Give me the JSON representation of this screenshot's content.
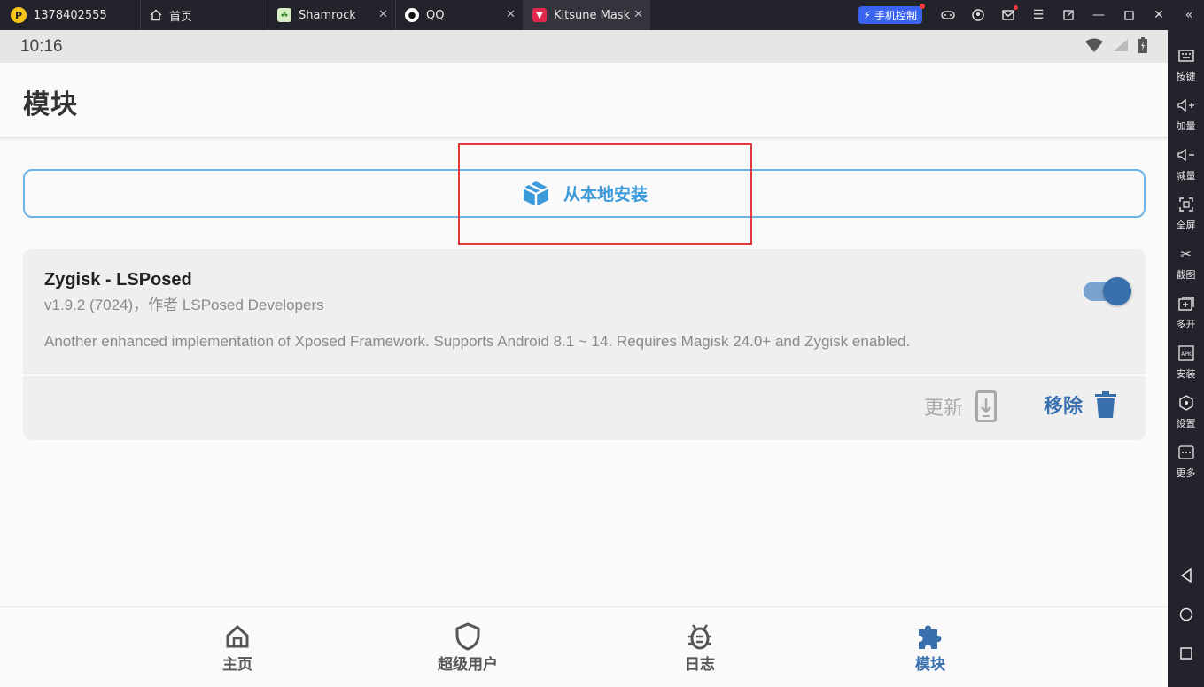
{
  "titlebar": {
    "account_id": "1378402555",
    "tabs": [
      {
        "label": "首页",
        "icon": "home-icon"
      },
      {
        "label": "Shamrock",
        "icon": "shamrock-app-icon"
      },
      {
        "label": "QQ",
        "icon": "qq-app-icon"
      },
      {
        "label": "Kitsune Mask",
        "icon": "kitsune-app-icon",
        "active": true
      }
    ],
    "phone_control_label": "手机控制"
  },
  "statusbar": {
    "time": "10:16"
  },
  "appbar": {
    "title": "模块"
  },
  "install_button": {
    "label": "从本地安装",
    "color": "#3d9ad9"
  },
  "module": {
    "name": "Zygisk - LSPosed",
    "version": "v1.9.2 (7024)，作者 LSPosed Developers",
    "description": "Another enhanced implementation of Xposed Framework. Supports Android 8.1 ~ 14. Requires Magisk 24.0+ and Zygisk enabled.",
    "enabled": true,
    "update_label": "更新",
    "remove_label": "移除"
  },
  "bottom_nav": [
    {
      "label": "主页",
      "icon": "home-icon"
    },
    {
      "label": "超级用户",
      "icon": "shield-icon"
    },
    {
      "label": "日志",
      "icon": "bug-icon"
    },
    {
      "label": "模块",
      "icon": "puzzle-icon",
      "active": true
    }
  ],
  "sidebar": [
    {
      "label": "按键",
      "icon": "keyboard-icon"
    },
    {
      "label": "加量",
      "icon": "volume-up-icon"
    },
    {
      "label": "减量",
      "icon": "volume-down-icon"
    },
    {
      "label": "全屏",
      "icon": "fullscreen-icon"
    },
    {
      "label": "截图",
      "icon": "scissors-icon"
    },
    {
      "label": "多开",
      "icon": "multi-instance-icon"
    },
    {
      "label": "安装",
      "icon": "apk-install-icon"
    },
    {
      "label": "设置",
      "icon": "settings-icon"
    },
    {
      "label": "更多",
      "icon": "more-icon"
    }
  ],
  "colors": {
    "accent": "#3a6fae",
    "install_accent": "#3d9ad9",
    "highlight": "#e03a3a",
    "emulator_chrome": "#23242b"
  }
}
